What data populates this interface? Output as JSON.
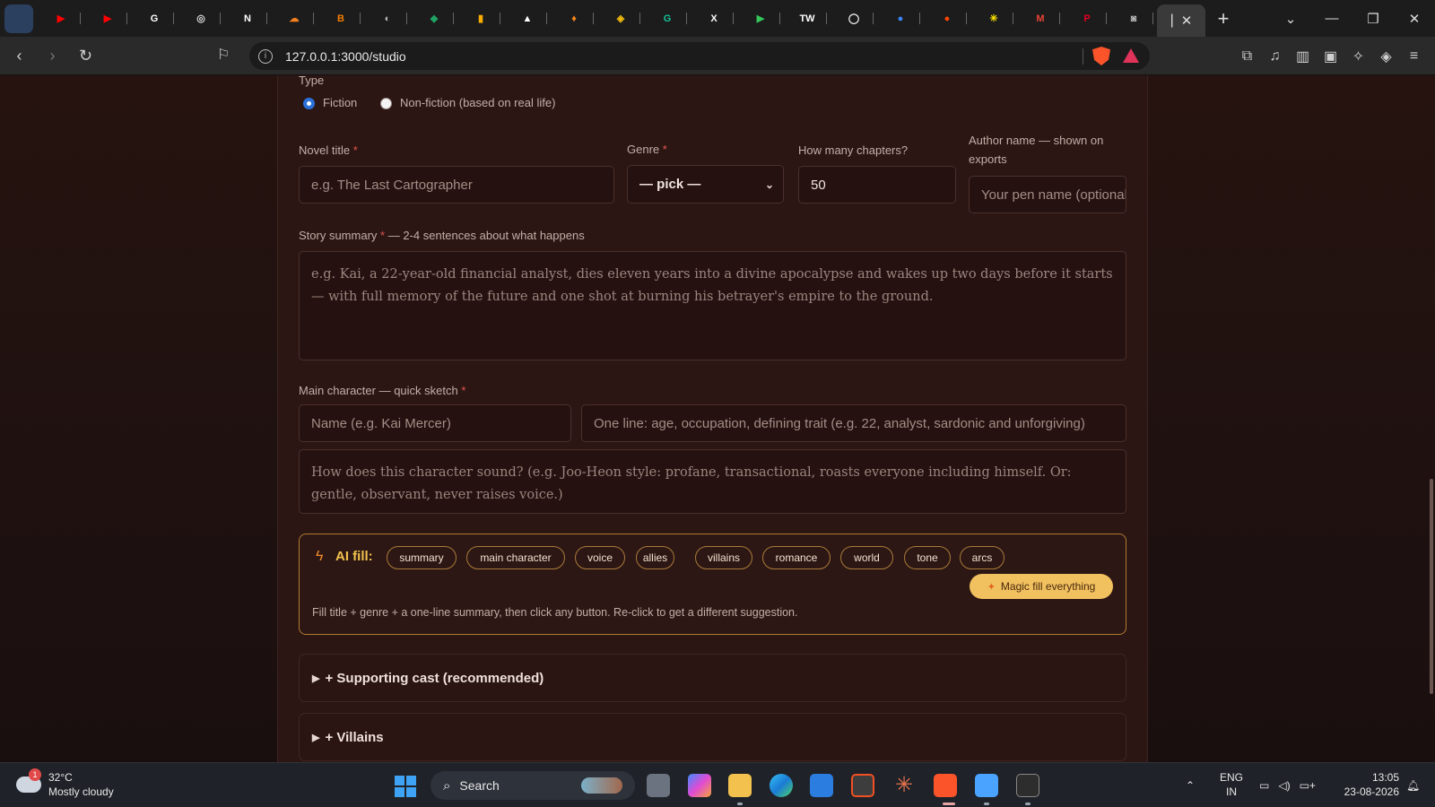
{
  "browser": {
    "url": "127.0.0.1:3000/studio",
    "tabs": [
      {
        "icon": "youtube-icon",
        "color": "#ff0000",
        "glyph": "▶"
      },
      {
        "icon": "youtube-icon",
        "color": "#ff0000",
        "glyph": "▶"
      },
      {
        "icon": "google-icon",
        "color": "#ffffff",
        "glyph": "G"
      },
      {
        "icon": "openai-icon",
        "color": "#dddddd",
        "glyph": "◎"
      },
      {
        "icon": "notion-icon",
        "color": "#ffffff",
        "glyph": "N"
      },
      {
        "icon": "cloud-icon",
        "color": "#f48120",
        "glyph": "☁"
      },
      {
        "icon": "blogger-icon",
        "color": "#f57d00",
        "glyph": "B"
      },
      {
        "icon": "globe-icon",
        "color": "#bbbbbb",
        "glyph": "◐"
      },
      {
        "icon": "drive-icon",
        "color": "#1fa463",
        "glyph": "◆"
      },
      {
        "icon": "analytics-icon",
        "color": "#f9ab00",
        "glyph": "▮"
      },
      {
        "icon": "triangle-icon",
        "color": "#ffffff",
        "glyph": "▲"
      },
      {
        "icon": "flame-icon",
        "color": "#f6851b",
        "glyph": "♦"
      },
      {
        "icon": "binance-icon",
        "color": "#f0b90b",
        "glyph": "◈"
      },
      {
        "icon": "grammarly-icon",
        "color": "#15c39a",
        "glyph": "G"
      },
      {
        "icon": "x-icon",
        "color": "#ffffff",
        "glyph": "X"
      },
      {
        "icon": "play-icon",
        "color": "#34c759",
        "glyph": "▶"
      },
      {
        "icon": "tw-icon",
        "color": "#ffffff",
        "glyph": "TW"
      },
      {
        "icon": "github-icon",
        "color": "#ffffff",
        "glyph": "◯"
      },
      {
        "icon": "toggle-icon",
        "color": "#3a86ff",
        "glyph": "●"
      },
      {
        "icon": "reddit-icon",
        "color": "#ff4500",
        "glyph": "●"
      },
      {
        "icon": "star-icon",
        "color": "#ffe600",
        "glyph": "✳"
      },
      {
        "icon": "gmail-icon",
        "color": "#ea4335",
        "glyph": "M"
      },
      {
        "icon": "pinterest-icon",
        "color": "#e60023",
        "glyph": "P"
      },
      {
        "icon": "camera-icon",
        "color": "#bbbbbb",
        "glyph": "◙"
      }
    ]
  },
  "form": {
    "type_label": "Type",
    "type_options": [
      "Fiction",
      "Non-fiction (based on real life)"
    ],
    "type_selected": "Fiction",
    "title_label": "Novel title",
    "title_placeholder": "e.g. The Last Cartographer",
    "genre_label": "Genre",
    "genre_value": "— pick —",
    "chapters_label": "How many chapters?",
    "chapters_value": "50",
    "author_label": "Author name — shown on exports",
    "author_placeholder": "Your pen name (optional)",
    "required_mark": "*",
    "summary_label": "Story summary",
    "summary_hint": "— 2-4 sentences about what happens",
    "summary_placeholder": "e.g. Kai, a 22-year-old financial analyst, dies eleven years into a divine apocalypse and wakes up two days before it starts — with full memory of the future and one shot at burning his betrayer's empire to the ground.",
    "character_label": "Main character — quick sketch",
    "character_name_placeholder": "Name (e.g. Kai Mercer)",
    "character_line_placeholder": "One line: age, occupation, defining trait (e.g. 22, analyst, sardonic and unforgiving)",
    "character_voice_placeholder": "How does this character sound? (e.g. Joo-Heon style: profane, transactional, roasts everyone including himself. Or: gentle, observant, never raises voice.)"
  },
  "ai_fill": {
    "label": "AI fill:",
    "chips": [
      "summary",
      "main character",
      "voice",
      "allies",
      "villains",
      "romance",
      "world",
      "tone",
      "arcs"
    ],
    "magic_label": "Magic fill everything",
    "hint": "Fill title + genre + a one-line summary, then click any button. Re-click to get a different suggestion."
  },
  "sections": [
    {
      "label": "+ Supporting cast (recommended)"
    },
    {
      "label": "+ Villains"
    }
  ],
  "taskbar": {
    "weather_temp": "32°C",
    "weather_desc": "Mostly cloudy",
    "weather_badge": "1",
    "search_label": "Search",
    "lang_1": "ENG",
    "lang_2": "IN",
    "time": "13:05",
    "date": "23-08-2026"
  },
  "colors": {
    "accent": "#f2c24d",
    "required": "#e2564d",
    "panel": "#2c1614"
  }
}
